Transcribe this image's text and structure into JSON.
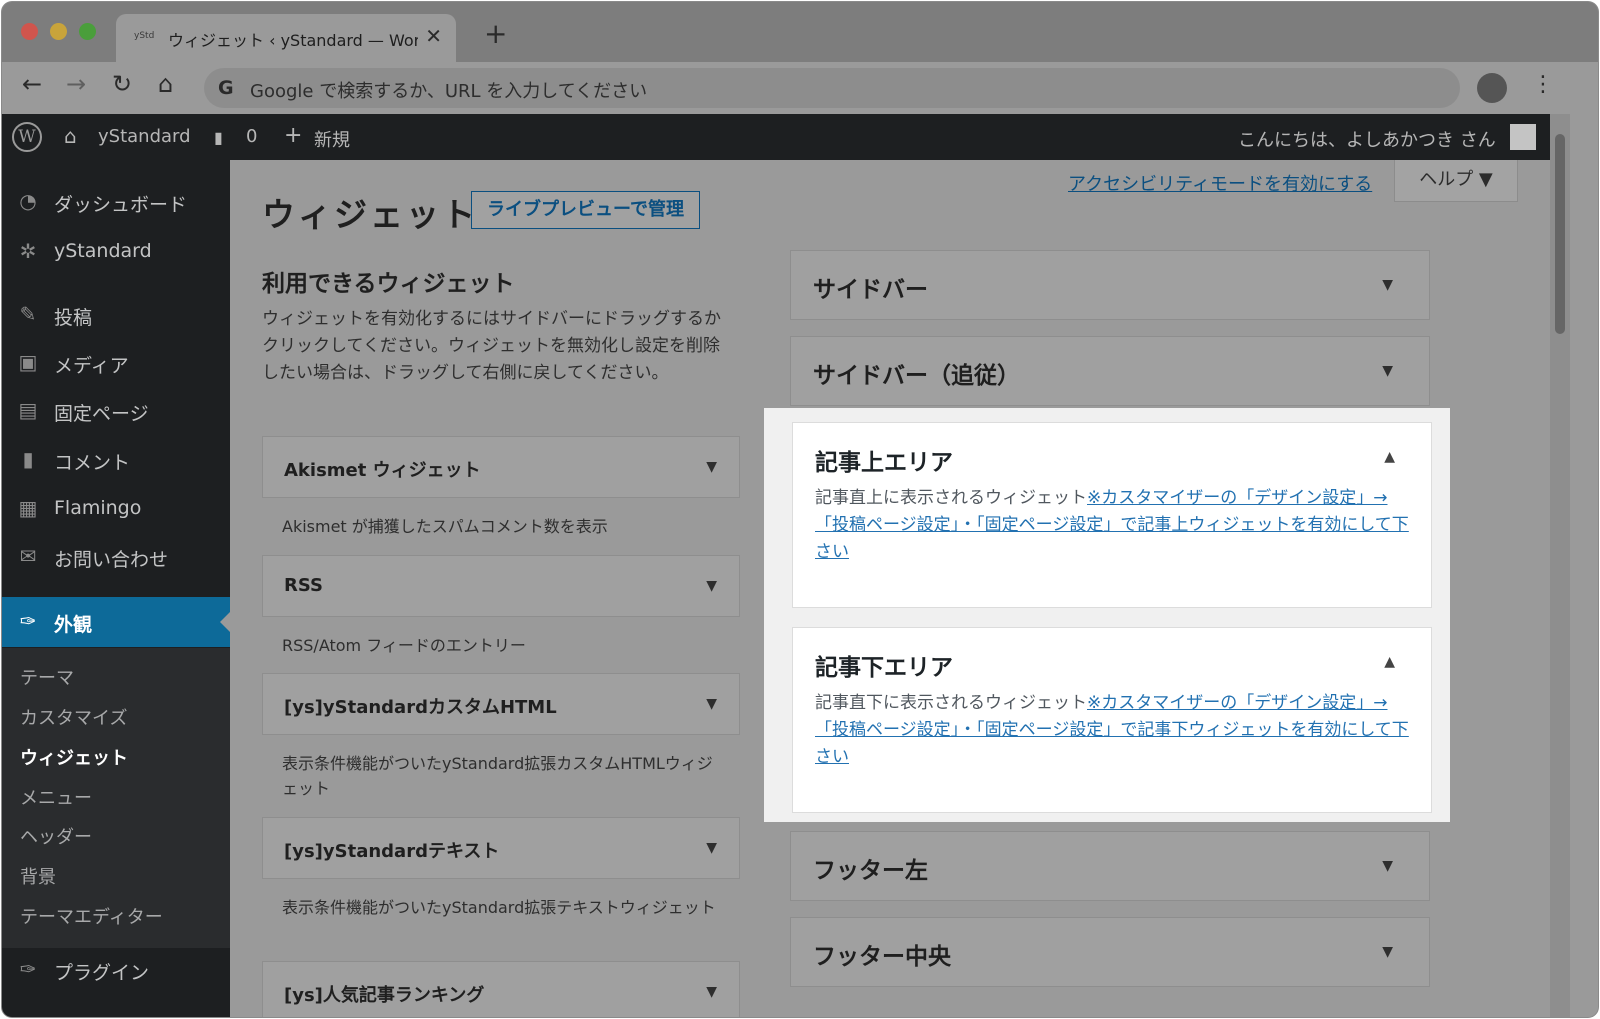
{
  "browser": {
    "tab_favicon": "yStd",
    "tab_title": "ウィジェット ‹ yStandard — WordPress",
    "tab_close": "✕",
    "new_tab": "+",
    "back": "←",
    "forward": "→",
    "reload": "↻",
    "home": "⌂",
    "google_icon": "G",
    "omnibox_placeholder": "Google で検索するか、URL を入力してください",
    "menu": "⋮"
  },
  "adminbar": {
    "logo": "W",
    "site_icon": "⌂",
    "site_name": "yStandard",
    "comment_icon": "▮",
    "comment_count": "0",
    "new_icon": "+",
    "new_label": "新規",
    "greeting": "こんにちは、よしあかつき さん"
  },
  "sidebar": {
    "items": [
      {
        "icon": "◔",
        "label": "ダッシュボード"
      },
      {
        "icon": "✲",
        "label": "yStandard"
      },
      {
        "icon": "✎",
        "label": "投稿"
      },
      {
        "icon": "▣",
        "label": "メディア"
      },
      {
        "icon": "▤",
        "label": "固定ページ"
      },
      {
        "icon": "▮",
        "label": "コメント"
      },
      {
        "icon": "▦",
        "label": "Flamingo"
      },
      {
        "icon": "✉",
        "label": "お問い合わせ"
      },
      {
        "icon": "✑",
        "label": "外観"
      },
      {
        "icon": "✑",
        "label": "プラグイン"
      }
    ],
    "submenu": [
      "テーマ",
      "カスタマイズ",
      "ウィジェット",
      "メニュー",
      "ヘッダー",
      "背景",
      "テーマエディター"
    ]
  },
  "content": {
    "accessibility_link": "アクセシビリティモードを有効にする",
    "help_label": "ヘルプ ▼",
    "page_title": "ウィジェット",
    "live_preview": "ライブプレビューで管理",
    "available_title": "利用できるウィジェット",
    "available_desc": "ウィジェットを有効化するにはサイドバーにドラッグするかクリックしてください。ウィジェットを無効化し設定を削除したい場合は、ドラッグして右側に戻してください。",
    "caret_down": "▼",
    "caret_up": "▲",
    "widgets": [
      {
        "name": "Akismet ウィジェット",
        "desc": "Akismet が捕獲したスパムコメント数を表示"
      },
      {
        "name": "RSS",
        "desc": "RSS/Atom フィードのエントリー"
      },
      {
        "name": "[ys]yStandardカスタムHTML",
        "desc": "表示条件機能がついたyStandard拡張カスタムHTMLウィジェット"
      },
      {
        "name": "[ys]yStandardテキスト",
        "desc": "表示条件機能がついたyStandard拡張テキストウィジェット"
      },
      {
        "name": "[ys]人気記事ランキング",
        "desc": ""
      }
    ],
    "areas": [
      {
        "name": "サイドバー"
      },
      {
        "name": "サイドバー（追従）"
      },
      {
        "name": "記事上エリア",
        "desc_plain": "記事直上に表示されるウィジェット",
        "desc_link": "※カスタマイザーの「デザイン設定」→「投稿ページ設定」・「固定ページ設定」で記事上ウィジェットを有効にして下さい"
      },
      {
        "name": "記事下エリア",
        "desc_plain": "記事直下に表示されるウィジェット",
        "desc_link": "※カスタマイザーの「デザイン設定」→「投稿ページ設定」・「固定ページ設定」で記事下ウィジェットを有効にして下さい"
      },
      {
        "name": "フッター左"
      },
      {
        "name": "フッター中央"
      }
    ]
  },
  "colors": {
    "admin_bar": "#1d1f21",
    "menu_active": "#0d6a99",
    "link": "#2271b1"
  }
}
